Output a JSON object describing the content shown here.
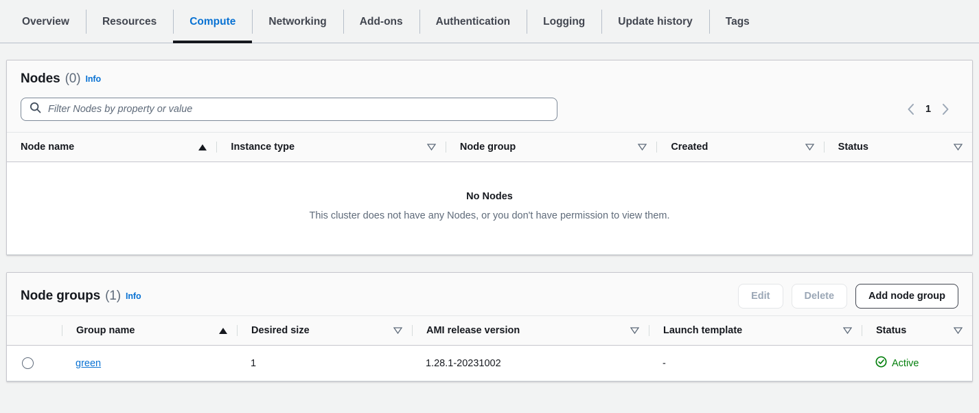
{
  "tabs": [
    {
      "label": "Overview",
      "active": false
    },
    {
      "label": "Resources",
      "active": false
    },
    {
      "label": "Compute",
      "active": true
    },
    {
      "label": "Networking",
      "active": false
    },
    {
      "label": "Add-ons",
      "active": false
    },
    {
      "label": "Authentication",
      "active": false
    },
    {
      "label": "Logging",
      "active": false
    },
    {
      "label": "Update history",
      "active": false
    },
    {
      "label": "Tags",
      "active": false
    }
  ],
  "nodes_panel": {
    "title": "Nodes",
    "count": "(0)",
    "info_label": "Info",
    "search": {
      "placeholder": "Filter Nodes by property or value",
      "value": ""
    },
    "pagination": {
      "prev_icon": "chevron-left-icon",
      "page": "1",
      "next_icon": "chevron-right-icon"
    },
    "columns": [
      {
        "label": "Node name",
        "sort": "asc"
      },
      {
        "label": "Instance type",
        "sort": "none"
      },
      {
        "label": "Node group",
        "sort": "none"
      },
      {
        "label": "Created",
        "sort": "none"
      },
      {
        "label": "Status",
        "sort": "none"
      }
    ],
    "empty": {
      "title": "No Nodes",
      "subtitle": "This cluster does not have any Nodes, or you don't have permission to view them."
    }
  },
  "node_groups_panel": {
    "title": "Node groups",
    "count": "(1)",
    "info_label": "Info",
    "actions": [
      {
        "label": "Edit",
        "state": "disabled"
      },
      {
        "label": "Delete",
        "state": "disabled"
      },
      {
        "label": "Add node group",
        "state": "normal"
      }
    ],
    "columns": [
      {
        "label": "Group name",
        "sort": "asc"
      },
      {
        "label": "Desired size",
        "sort": "none"
      },
      {
        "label": "AMI release version",
        "sort": "none"
      },
      {
        "label": "Launch template",
        "sort": "none"
      },
      {
        "label": "Status",
        "sort": "none"
      }
    ],
    "rows": [
      {
        "selected": false,
        "group_name": "green",
        "desired_size": "1",
        "ami_release_version": "1.28.1-20231002",
        "launch_template": "-",
        "status": "Active",
        "status_icon": "check-circle-icon"
      }
    ]
  },
  "colors": {
    "link": "#0972d3",
    "active_tab_underline": "#16191f",
    "status_success": "#037f0c",
    "page_background": "#f2f3f3"
  }
}
